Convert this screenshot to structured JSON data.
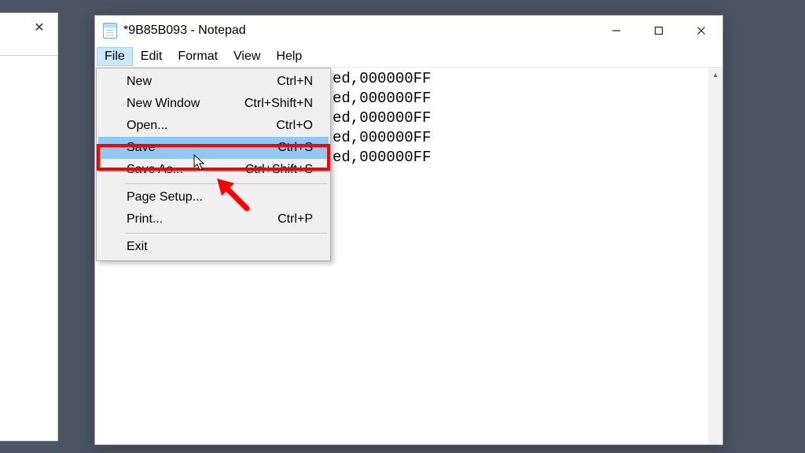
{
  "bg_window": {
    "present": true
  },
  "window": {
    "title": "*9B85B093 - Notepad"
  },
  "menubar": {
    "items": [
      "File",
      "Edit",
      "Format",
      "View",
      "Help"
    ],
    "active_index": 0
  },
  "dropdown": {
    "items": [
      {
        "label": "New",
        "shortcut": "Ctrl+N"
      },
      {
        "label": "New Window",
        "shortcut": "Ctrl+Shift+N"
      },
      {
        "label": "Open...",
        "shortcut": "Ctrl+O"
      },
      {
        "label": "Save",
        "shortcut": "Ctrl+S",
        "highlighted": true,
        "emphasized": true
      },
      {
        "label": "Save As...",
        "shortcut": "Ctrl+Shift+S"
      },
      {
        "sep": true
      },
      {
        "label": "Page Setup...",
        "shortcut": ""
      },
      {
        "label": "Print...",
        "shortcut": "Ctrl+P"
      },
      {
        "sep": true
      },
      {
        "label": "Exit",
        "shortcut": ""
      }
    ]
  },
  "content": {
    "visible_lines": [
      "ed,000000FF",
      "ed,000000FF",
      "ed,000000FF",
      "ed,000000FF",
      "ed,000000FF"
    ]
  },
  "annotation": {
    "red_box_target": "menu-save",
    "arrow_points_to": "menu-save"
  }
}
